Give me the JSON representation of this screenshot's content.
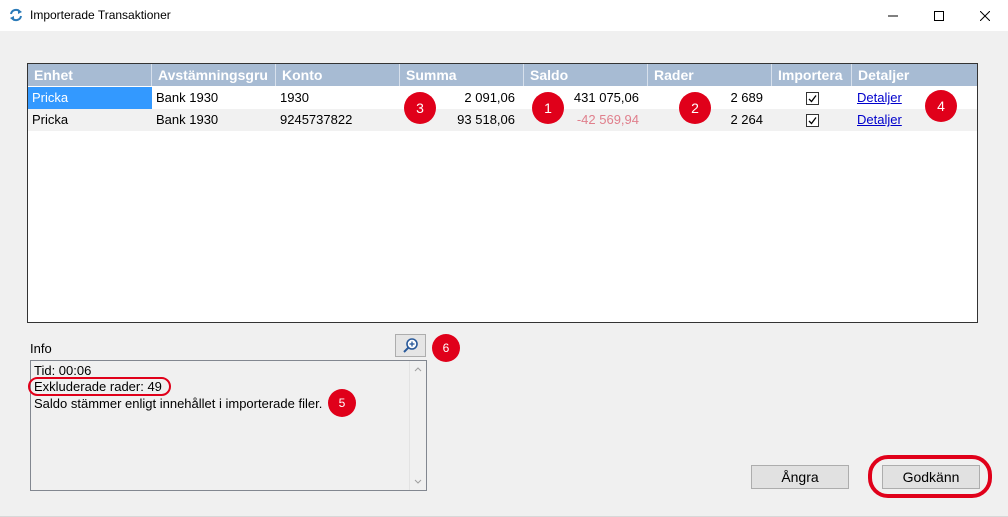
{
  "window": {
    "title": "Importerade Transaktioner"
  },
  "grid": {
    "columns": [
      "Enhet",
      "Avstämningsgru",
      "Konto",
      "Summa",
      "Saldo",
      "Rader",
      "Importera",
      "Detaljer"
    ],
    "rows": [
      {
        "enhet": "Pricka",
        "avstamningsgrupp": "Bank 1930",
        "konto": "1930",
        "summa": "2 091,06",
        "saldo": "431 075,06",
        "rader": "2 689",
        "importera": true,
        "detaljer": "Detaljer"
      },
      {
        "enhet": "Pricka",
        "avstamningsgrupp": "Bank 1930",
        "konto": "9245737822",
        "summa": "93 518,06",
        "saldo": "-42 569,94",
        "rader": "2 264",
        "importera": true,
        "detaljer": "Detaljer"
      }
    ]
  },
  "info": {
    "label": "Info",
    "lines": [
      "Tid: 00:06",
      "Exkluderade rader: 49",
      "Saldo stämmer enligt innehållet i importerade filer."
    ]
  },
  "buttons": {
    "undo": "Ångra",
    "approve": "Godkänn"
  },
  "annotations": [
    "1",
    "2",
    "3",
    "4",
    "5",
    "6"
  ],
  "colors": {
    "header_bg": "#a7bbd3",
    "selection": "#3399ff",
    "negative": "#e07f8c",
    "annotation": "#e0001a",
    "link": "#0000cc"
  },
  "icons": {
    "app": "refresh-arrows-icon",
    "zoom": "zoom-in-icon"
  }
}
